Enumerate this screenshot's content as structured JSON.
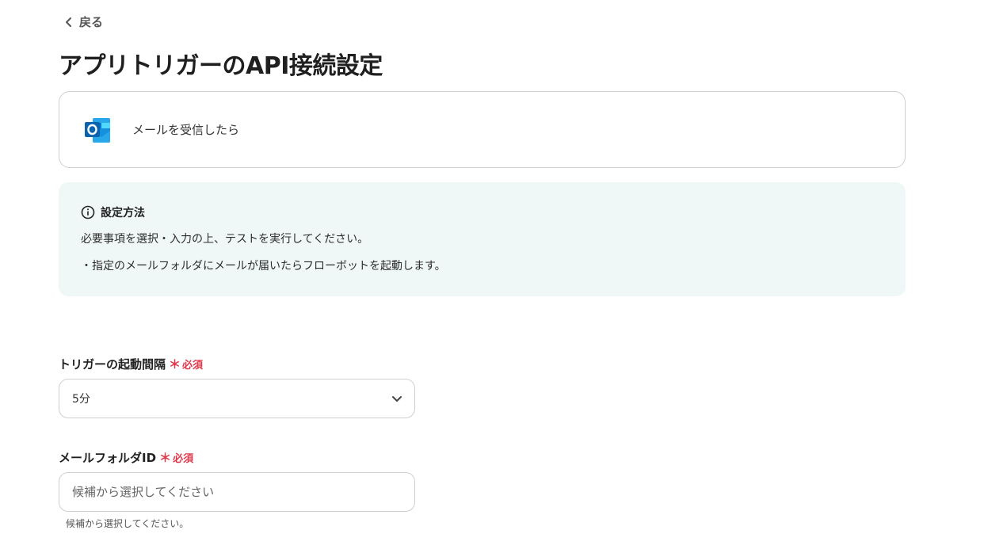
{
  "nav": {
    "back_label": "戻る"
  },
  "page": {
    "title": "アプリトリガーのAPI接続設定"
  },
  "app_card": {
    "icon": "outlook-icon",
    "trigger_label": "メールを受信したら"
  },
  "info": {
    "heading": "設定方法",
    "lines": [
      "必要事項を選択・入力の上、テストを実行してください。",
      "・指定のメールフォルダにメールが届いたらフローボットを起動します。"
    ]
  },
  "fields": {
    "interval": {
      "label": "トリガーの起動間隔",
      "required_mark": "＊",
      "required_label": "必須",
      "value": "5分"
    },
    "folder_id": {
      "label": "メールフォルダID",
      "required_mark": "＊",
      "required_label": "必須",
      "placeholder": "候補から選択してください",
      "help": "候補から選択してください。"
    }
  },
  "colors": {
    "required": "#e0384b",
    "info_bg": "#f0f8f7",
    "border": "#cfcfcf"
  }
}
